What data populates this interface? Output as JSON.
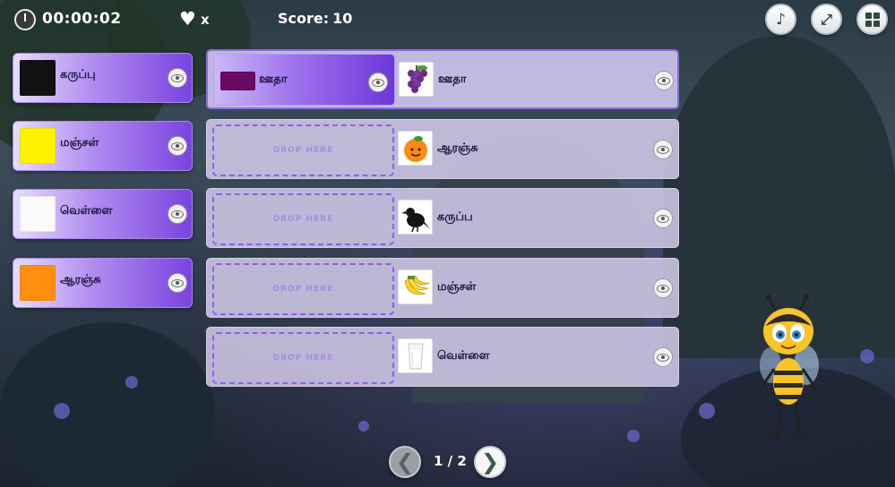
{
  "topbar": {
    "timer": "00:00:02",
    "lives": "x",
    "score_label": "Score:",
    "score_value": "10",
    "icons": [
      "music-icon",
      "fullscreen-icon",
      "menu-grid-icon"
    ]
  },
  "cards": [
    {
      "label": "கருப்பு",
      "color": "#121012"
    },
    {
      "label": "மஞ்சள்",
      "color": "#fff200"
    },
    {
      "label": "வெள்ளை",
      "color": "#fafafa"
    },
    {
      "label": "ஆரஞ்சு",
      "color": "#ff8f0f"
    }
  ],
  "rows": [
    {
      "placed": {
        "label": "ஊதா",
        "color": "#6b0a63"
      },
      "item": "grapes",
      "label": "ஊதா"
    },
    {
      "drop_text": "DROP HERE",
      "item": "orange",
      "label": "ஆரஞ்சு"
    },
    {
      "drop_text": "DROP HERE",
      "item": "crow",
      "label": "கருப்ப"
    },
    {
      "drop_text": "DROP HERE",
      "item": "bananas",
      "label": "மஞ்சள்"
    },
    {
      "drop_text": "DROP HERE",
      "item": "glass-of-milk",
      "label": "வெள்ளை"
    }
  ],
  "pagination": {
    "text": "1 / 2"
  }
}
